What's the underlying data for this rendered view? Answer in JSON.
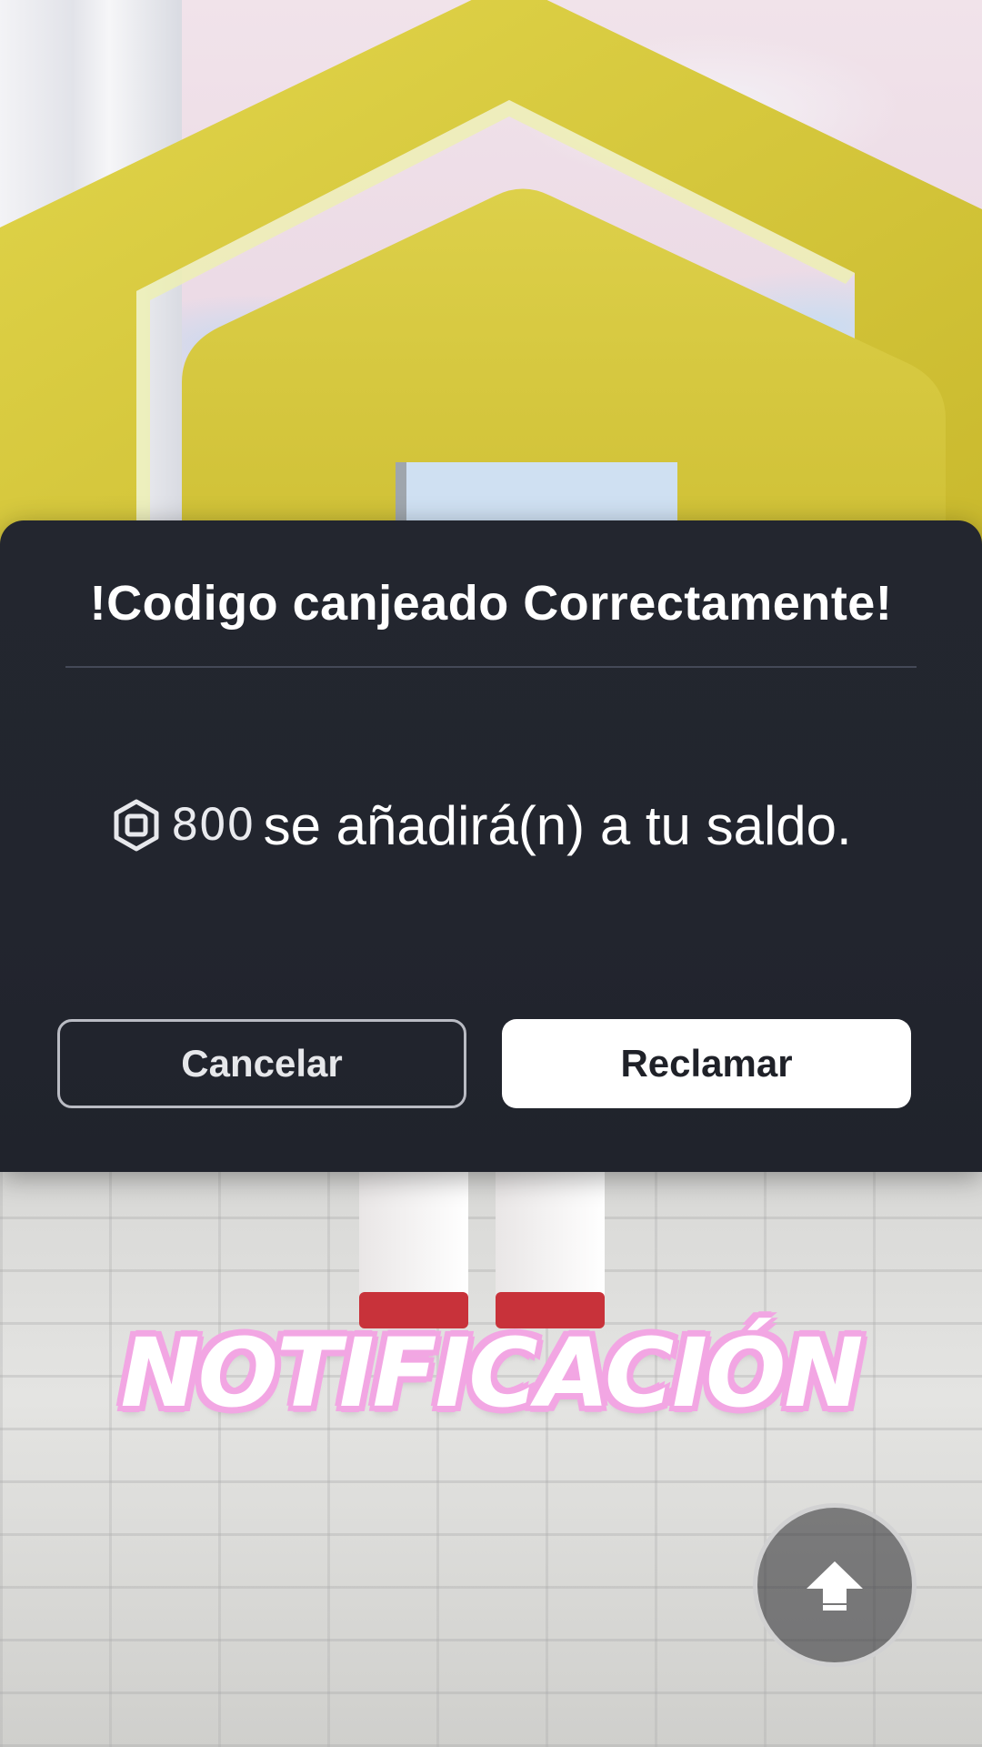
{
  "dialog": {
    "title": "!Codigo canjeado Correctamente!",
    "currency_icon": "robux-icon",
    "amount": "800",
    "message": "se añadirá(n) a tu saldo.",
    "cancel_label": "Cancelar",
    "claim_label": "Reclamar"
  },
  "overlay": {
    "caption": "NOTIFICACIÓN",
    "caption_color": "#f2a6e3"
  },
  "controls": {
    "jump_icon": "jump-arrow-icon"
  },
  "colors": {
    "modal_bg": "#23262f",
    "claim_bg": "#ffffff",
    "emblem_yellow": "#d9c93c"
  }
}
